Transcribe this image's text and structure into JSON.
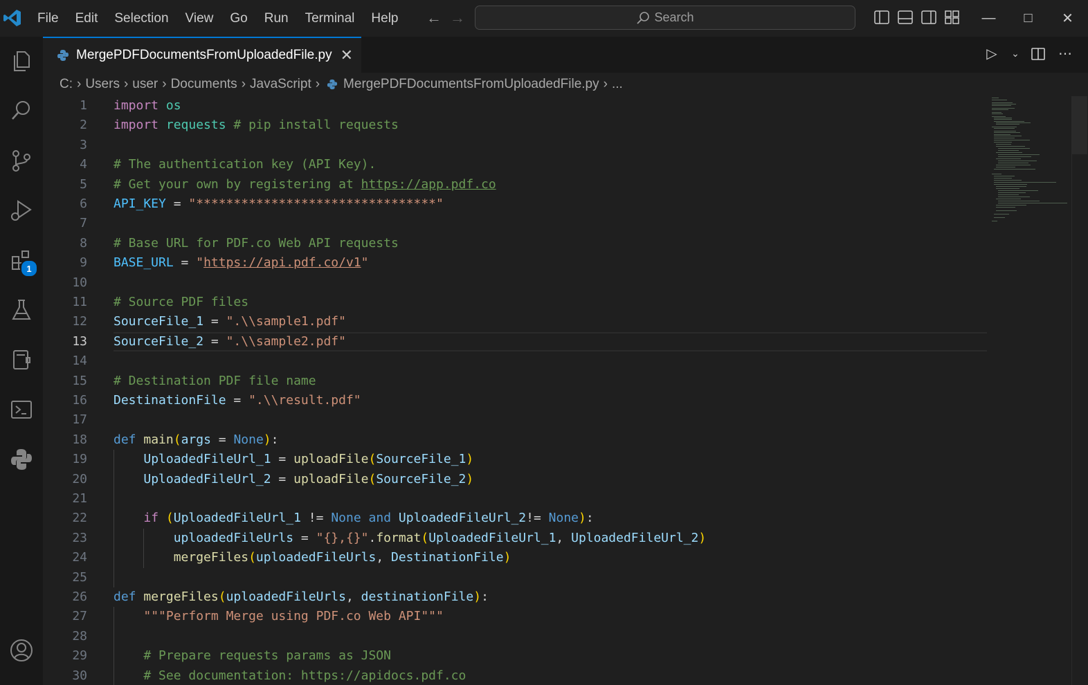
{
  "menu": [
    "File",
    "Edit",
    "Selection",
    "View",
    "Go",
    "Run",
    "Terminal",
    "Help"
  ],
  "search": {
    "label": "Search"
  },
  "tab": {
    "label": "MergePDFDocumentsFromUploadedFile.py"
  },
  "breadcrumb": [
    "C:",
    "Users",
    "user",
    "Documents",
    "JavaScript",
    "MergePDFDocumentsFromUploadedFile.py",
    "..."
  ],
  "extensions_badge": "1",
  "active_line": 13,
  "code_lines": [
    [
      [
        "kw",
        "import"
      ],
      [
        "pl",
        " "
      ],
      [
        "mod",
        "os"
      ]
    ],
    [
      [
        "kw",
        "import"
      ],
      [
        "pl",
        " "
      ],
      [
        "mod",
        "requests"
      ],
      [
        "pl",
        " "
      ],
      [
        "cm",
        "# pip install requests"
      ]
    ],
    [],
    [
      [
        "cm",
        "# The authentication key (API Key)."
      ]
    ],
    [
      [
        "cm",
        "# Get your own by registering at "
      ],
      [
        "cmu",
        "https://app.pdf.co"
      ]
    ],
    [
      [
        "cn",
        "API_KEY"
      ],
      [
        "pl",
        " = "
      ],
      [
        "st",
        "\"********************************\""
      ]
    ],
    [],
    [
      [
        "cm",
        "# Base URL for PDF.co Web API requests"
      ]
    ],
    [
      [
        "cn",
        "BASE_URL"
      ],
      [
        "pl",
        " = "
      ],
      [
        "st",
        "\""
      ],
      [
        "stu",
        "https://api.pdf.co/v1"
      ],
      [
        "st",
        "\""
      ]
    ],
    [],
    [
      [
        "cm",
        "# Source PDF files"
      ]
    ],
    [
      [
        "vr",
        "SourceFile_1"
      ],
      [
        "pl",
        " = "
      ],
      [
        "st",
        "\".\\\\sample1.pdf\""
      ]
    ],
    [
      [
        "vr",
        "SourceFile_2"
      ],
      [
        "pl",
        " = "
      ],
      [
        "st",
        "\".\\\\sample2.pdf\""
      ]
    ],
    [],
    [
      [
        "cm",
        "# Destination PDF file name"
      ]
    ],
    [
      [
        "vr",
        "DestinationFile"
      ],
      [
        "pl",
        " = "
      ],
      [
        "st",
        "\".\\\\result.pdf\""
      ]
    ],
    [],
    [
      [
        "kb",
        "def"
      ],
      [
        "pl",
        " "
      ],
      [
        "fn",
        "main"
      ],
      [
        "br1",
        "("
      ],
      [
        "vr",
        "args"
      ],
      [
        "pl",
        " = "
      ],
      [
        "kb",
        "None"
      ],
      [
        "br1",
        ")"
      ],
      [
        "pl",
        ":"
      ]
    ],
    [
      [
        "pl",
        "    "
      ],
      [
        "vr",
        "UploadedFileUrl_1"
      ],
      [
        "pl",
        " = "
      ],
      [
        "fn",
        "uploadFile"
      ],
      [
        "br1",
        "("
      ],
      [
        "vr",
        "SourceFile_1"
      ],
      [
        "br1",
        ")"
      ]
    ],
    [
      [
        "pl",
        "    "
      ],
      [
        "vr",
        "UploadedFileUrl_2"
      ],
      [
        "pl",
        " = "
      ],
      [
        "fn",
        "uploadFile"
      ],
      [
        "br1",
        "("
      ],
      [
        "vr",
        "SourceFile_2"
      ],
      [
        "br1",
        ")"
      ]
    ],
    [],
    [
      [
        "pl",
        "    "
      ],
      [
        "kw",
        "if"
      ],
      [
        "pl",
        " "
      ],
      [
        "br1",
        "("
      ],
      [
        "vr",
        "UploadedFileUrl_1"
      ],
      [
        "pl",
        " != "
      ],
      [
        "kb",
        "None"
      ],
      [
        "pl",
        " "
      ],
      [
        "kb",
        "and"
      ],
      [
        "pl",
        " "
      ],
      [
        "vr",
        "UploadedFileUrl_2"
      ],
      [
        "pl",
        "!= "
      ],
      [
        "kb",
        "None"
      ],
      [
        "br1",
        ")"
      ],
      [
        "pl",
        ":"
      ]
    ],
    [
      [
        "pl",
        "        "
      ],
      [
        "vr",
        "uploadedFileUrls"
      ],
      [
        "pl",
        " = "
      ],
      [
        "st",
        "\"{},{}\""
      ],
      [
        "pl",
        "."
      ],
      [
        "fn",
        "format"
      ],
      [
        "br1",
        "("
      ],
      [
        "vr",
        "UploadedFileUrl_1"
      ],
      [
        "pl",
        ", "
      ],
      [
        "vr",
        "UploadedFileUrl_2"
      ],
      [
        "br1",
        ")"
      ]
    ],
    [
      [
        "pl",
        "        "
      ],
      [
        "fn",
        "mergeFiles"
      ],
      [
        "br1",
        "("
      ],
      [
        "vr",
        "uploadedFileUrls"
      ],
      [
        "pl",
        ", "
      ],
      [
        "vr",
        "DestinationFile"
      ],
      [
        "br1",
        ")"
      ]
    ],
    [],
    [
      [
        "kb",
        "def"
      ],
      [
        "pl",
        " "
      ],
      [
        "fn",
        "mergeFiles"
      ],
      [
        "br1",
        "("
      ],
      [
        "vr",
        "uploadedFileUrls"
      ],
      [
        "pl",
        ", "
      ],
      [
        "vr",
        "destinationFile"
      ],
      [
        "br1",
        ")"
      ],
      [
        "pl",
        ":"
      ]
    ],
    [
      [
        "pl",
        "    "
      ],
      [
        "st",
        "\"\"\"Perform Merge using PDF.co Web API\"\"\""
      ]
    ],
    [],
    [
      [
        "pl",
        "    "
      ],
      [
        "cm",
        "# Prepare requests params as JSON"
      ]
    ],
    [
      [
        "pl",
        "    "
      ],
      [
        "cm",
        "# See documentation: https://apidocs.pdf.co"
      ]
    ]
  ]
}
